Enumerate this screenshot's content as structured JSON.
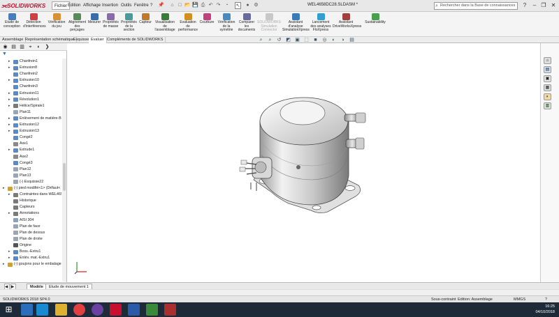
{
  "app": {
    "brand": "SOLIDWORKS",
    "document_title": "WEL4658DC28.SLDASM *",
    "search_placeholder": "Rechercher dans la Base de connaissances"
  },
  "menus": [
    "Fichier",
    "Edition",
    "Affichage",
    "Insertion",
    "Outils",
    "Fenêtre",
    "?"
  ],
  "ribbon": [
    {
      "label": "Etude de conception",
      "color": "#4a7bbf"
    },
    {
      "label": "Détection d'interférences",
      "color": "#d04040"
    },
    {
      "label": "Vérification du jeu",
      "color": "#d89030"
    },
    {
      "label": "Alignement des perçages",
      "color": "#5a8a5a"
    },
    {
      "label": "Mesurer",
      "color": "#3a6ea8"
    },
    {
      "label": "Propriétés de masse",
      "color": "#8a6aa8"
    },
    {
      "label": "Propriétés de la section",
      "color": "#4a9a9a"
    },
    {
      "label": "Capteur",
      "color": "#c07a30"
    },
    {
      "label": "Visualisation de l'assemblage",
      "color": "#3a7a3a"
    },
    {
      "label": "Evaluation de performance",
      "color": "#d09020"
    },
    {
      "label": "Courbure",
      "color": "#c04080"
    },
    {
      "label": "Vérification de la symétrie",
      "color": "#4a8ac0"
    },
    {
      "label": "Comparer les documents",
      "color": "#6a6a9a"
    },
    {
      "label": "SOLIDWORKS Simulation Connector",
      "color": "#c8c8c8",
      "disabled": true
    },
    {
      "label": "Assistant d'analyse SimulationXpress",
      "color": "#3a7ab8"
    },
    {
      "label": "Lancement des analyses FloXpress",
      "color": "#30a0d0"
    },
    {
      "label": "Assistant DriveWorksXpress",
      "color": "#a04040"
    },
    {
      "label": "Sustainability",
      "color": "#4aa04a"
    }
  ],
  "command_tabs": [
    "Assemblage",
    "Représentation schématique",
    "Esquisse",
    "Evaluer",
    "Compléments de SOLIDWORKS"
  ],
  "active_command_tab": "Evaluer",
  "tree": [
    {
      "label": "Chanfrein1",
      "exp": true,
      "icon": "#5a8ac8"
    },
    {
      "label": "Extrusion8",
      "exp": true,
      "icon": "#5a8ac8"
    },
    {
      "label": "Chanfrein2",
      "exp": false,
      "icon": "#5a8ac8"
    },
    {
      "label": "Extrusion10",
      "exp": true,
      "icon": "#5a8ac8"
    },
    {
      "label": "Chanfrein3",
      "exp": false,
      "icon": "#5a8ac8"
    },
    {
      "label": "Extrusion11",
      "exp": true,
      "icon": "#5a8ac8"
    },
    {
      "label": "Révolution1",
      "exp": true,
      "icon": "#5a8ac8"
    },
    {
      "label": "Hélice/Spirale1",
      "exp": true,
      "icon": "#7a7a7a"
    },
    {
      "label": "Plan11",
      "exp": false,
      "icon": "#9aa6b8"
    },
    {
      "label": "Enlèvement de matière-B",
      "exp": true,
      "icon": "#5a8ac8"
    },
    {
      "label": "Extrusion12",
      "exp": true,
      "icon": "#5a8ac8"
    },
    {
      "label": "Extrusion13",
      "exp": true,
      "icon": "#5a8ac8"
    },
    {
      "label": "Congé2",
      "exp": false,
      "icon": "#5a8ac8"
    },
    {
      "label": "Axe1",
      "exp": false,
      "icon": "#8a8a8a"
    },
    {
      "label": "Extrude1",
      "exp": true,
      "icon": "#5a8ac8"
    },
    {
      "label": "Axe2",
      "exp": false,
      "icon": "#8a8a8a"
    },
    {
      "label": "Congé3",
      "exp": false,
      "icon": "#5a8ac8"
    },
    {
      "label": "Plan12",
      "exp": false,
      "icon": "#9aa6b8"
    },
    {
      "label": "Plan13",
      "exp": false,
      "icon": "#9aa6b8"
    },
    {
      "label": "(-) Esquisse22",
      "exp": false,
      "icon": "#9aa6b8"
    },
    {
      "label": "(-) pied modifié<1> (Défaut<",
      "exp": true,
      "icon": "#d6a020",
      "level": 0
    },
    {
      "label": "Contraintes dans WEL465",
      "exp": true,
      "icon": "#7a7a7a"
    },
    {
      "label": "Historique",
      "exp": false,
      "icon": "#7a7a7a"
    },
    {
      "label": "Capteurs",
      "exp": false,
      "icon": "#7a7a7a"
    },
    {
      "label": "Annotations",
      "exp": true,
      "icon": "#7a7a7a"
    },
    {
      "label": "AISI 304",
      "exp": false,
      "icon": "#8aa0c0"
    },
    {
      "label": "Plan de face",
      "exp": false,
      "icon": "#9aa6b8"
    },
    {
      "label": "Plan de dessus",
      "exp": false,
      "icon": "#9aa6b8"
    },
    {
      "label": "Plan de droite",
      "exp": false,
      "icon": "#9aa6b8"
    },
    {
      "label": "Origine",
      "exp": false,
      "icon": "#555555"
    },
    {
      "label": "Boss.-Extru1",
      "exp": true,
      "icon": "#5a8ac8"
    },
    {
      "label": "Enlév. mat.-Extru1",
      "exp": true,
      "icon": "#5a8ac8"
    },
    {
      "label": "(-) goujons pour le embalage",
      "exp": true,
      "icon": "#d6a020",
      "level": 0
    }
  ],
  "bottom_tabs": [
    "Modèle",
    "Etude de mouvement 1"
  ],
  "status": {
    "app_version": "SOLIDWORKS 2018 SP4.0",
    "constraint": "Sous-contraint",
    "mode": "Edition: Assemblage",
    "units": "MMGS"
  },
  "clock": {
    "time": "16:25",
    "date": "04/10/2018"
  }
}
